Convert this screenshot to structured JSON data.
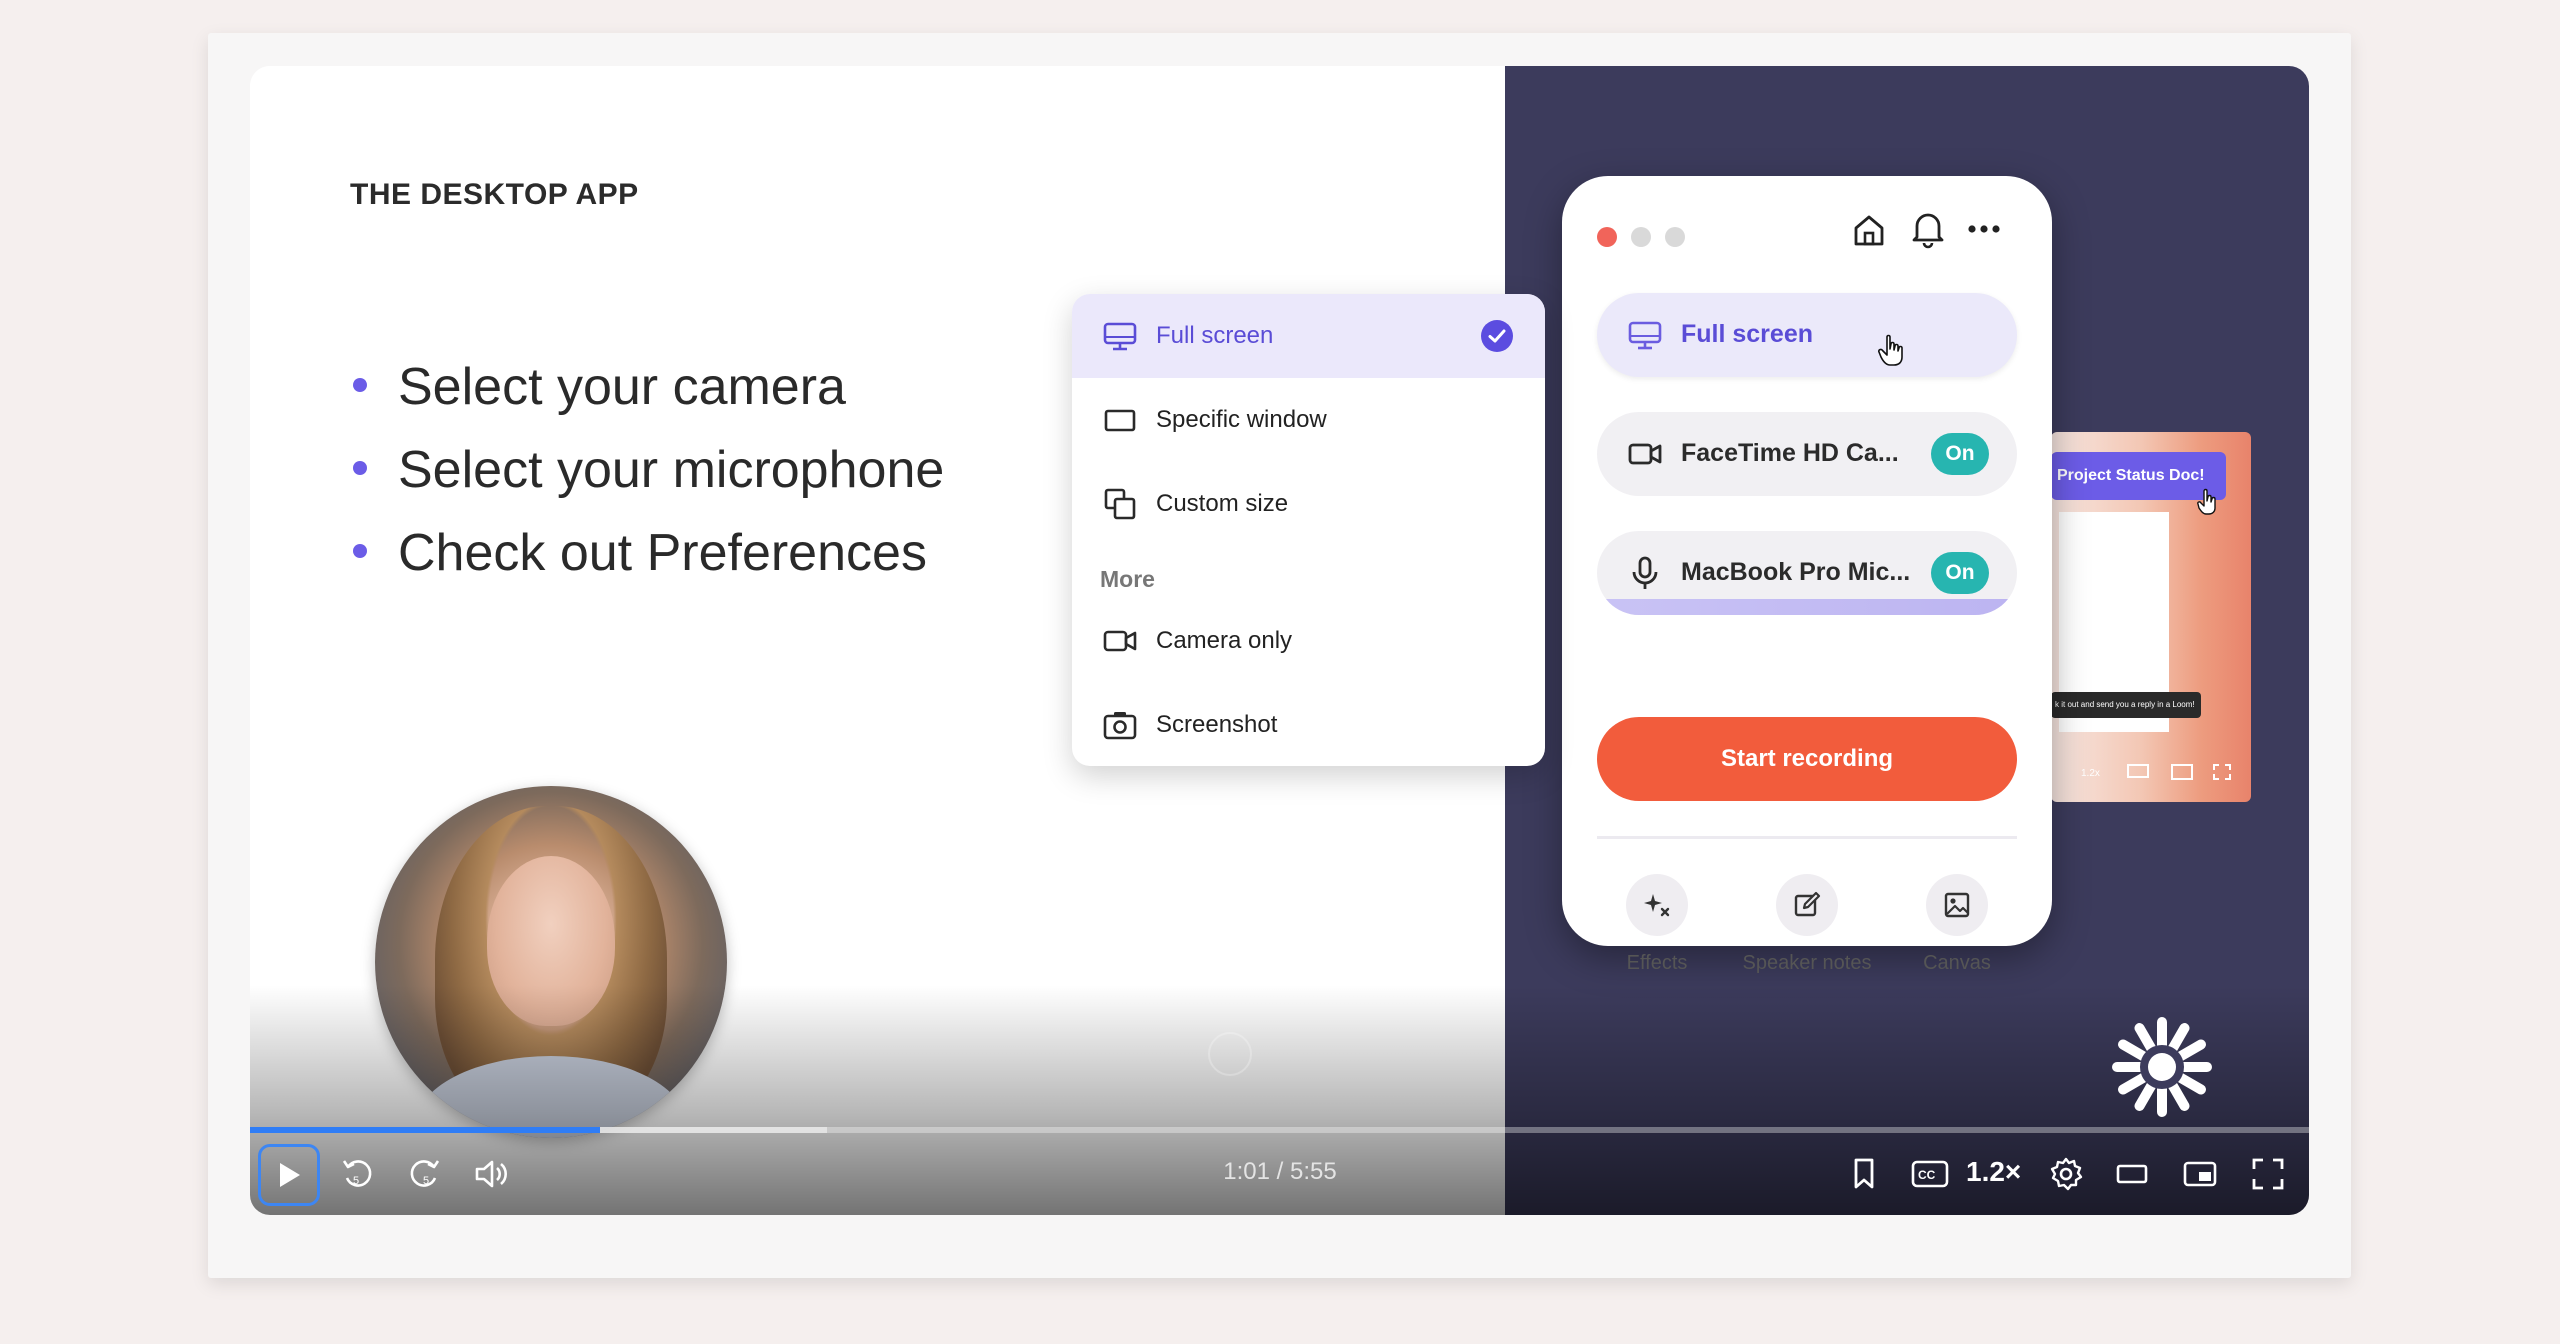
{
  "slide": {
    "title": "THE DESKTOP APP",
    "bullets": [
      "Select your camera",
      "Select your microphone",
      "Check out Preferences"
    ]
  },
  "dropdown": {
    "items": [
      {
        "label": "Full screen",
        "icon": "monitor-icon",
        "selected": true
      },
      {
        "label": "Specific window",
        "icon": "window-icon",
        "selected": false
      },
      {
        "label": "Custom size",
        "icon": "custom-size-icon",
        "selected": false
      }
    ],
    "more_heading": "More",
    "more_items": [
      {
        "label": "Camera only",
        "icon": "camera-icon"
      },
      {
        "label": "Screenshot",
        "icon": "screenshot-icon"
      }
    ]
  },
  "app": {
    "source_label": "Full screen",
    "camera_label": "FaceTime HD Ca...",
    "camera_state": "On",
    "mic_label": "MacBook Pro Mic...",
    "mic_state": "On",
    "start_label": "Start recording",
    "tools": [
      "Effects",
      "Speaker notes",
      "Canvas"
    ]
  },
  "preview": {
    "tag_label": "Project Status Doc!",
    "tooltip": "k it out and send you a reply in a Loom!",
    "speed": "1.2x"
  },
  "player": {
    "time": "1:01 / 5:55",
    "progress_fraction": 0.17,
    "buffered_fraction": 0.28,
    "speed": "1.2×"
  },
  "colors": {
    "accent": "#5b4ce0",
    "record": "#f25c3c",
    "on_badge": "#27b5b0",
    "progress": "#2f7df6",
    "right_bg": "#3c3b5c"
  }
}
